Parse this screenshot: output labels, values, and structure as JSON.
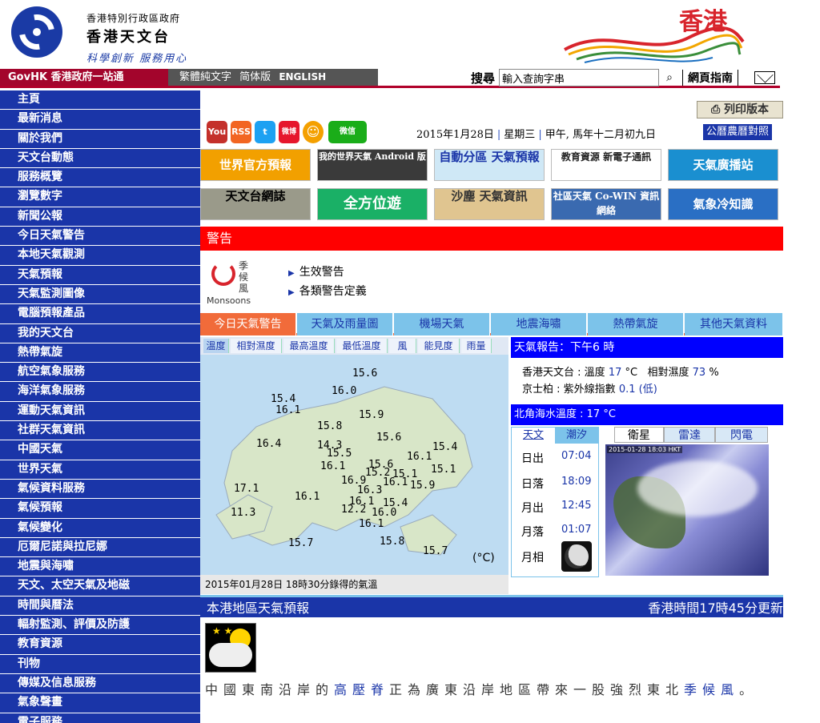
{
  "header": {
    "org_line1": "香港特別行政區政府",
    "org_line2": "香港天文台",
    "slogan": "科學創新 服務用心",
    "brand": "香港"
  },
  "topnav": {
    "govhk": "GovHK 香港政府一站通",
    "langs": [
      "繁體純文字",
      "简体版",
      "ENGLISH"
    ],
    "search_label": "搜尋",
    "search_placeholder": "輸入查詢字串",
    "site_guide": "網頁指南"
  },
  "sidebar": {
    "items": [
      "主頁",
      "最新消息",
      "關於我們",
      "天文台動態",
      "服務概覽",
      "瀏覽數字",
      "新聞公報",
      "今日天氣警告",
      "本地天氣觀測",
      "天氣預報",
      "天氣監測圖像",
      "電腦預報產品",
      "我的天文台",
      "熱帶氣旋",
      "航空氣象服務",
      "海洋氣象服務",
      "運動天氣資訊",
      "社群天氣資訊",
      "中國天氣",
      "世界天氣",
      "氣候資料服務",
      "氣候預報",
      "氣候變化",
      "厄爾尼諾與拉尼娜",
      "地震與海嘯",
      "天文、太空天氣及地磁",
      "時間與曆法",
      "輻射監測、評價及防護",
      "教育資源",
      "刊物",
      "傳媒及信息服務",
      "氣象聲畫",
      "電子服務"
    ]
  },
  "toolbar": {
    "print_label": "列印版本"
  },
  "social": [
    "You",
    "RSS",
    "t",
    "微博",
    "☺",
    "微信"
  ],
  "date": {
    "gregorian": "2015年1月28日",
    "weekday": "星期三",
    "lunar": "甲午, 馬年十二月初九日",
    "lunar_link": "公曆農曆對照"
  },
  "banners": {
    "row1": [
      "世界官方預報",
      "我的世界天氣 Android 版",
      "自動分區 天氣預報",
      "教育資源 新電子通訊",
      "天氣廣播站"
    ],
    "row2": [
      "天文台網誌",
      "全方位遊",
      "沙塵 天氣資訊",
      "社區天氣 Co-WIN 資訊網絡",
      "氣象冷知識"
    ]
  },
  "warnings": {
    "title": "警告",
    "monsoon_chars": "季候風",
    "monsoon_en": "Monsoons",
    "links": [
      "生效警告",
      "各類警告定義"
    ]
  },
  "tabs": [
    "今日天氣警告",
    "天氣及雨量圖",
    "機場天氣",
    "地震海嘯",
    "熱帶氣旋",
    "其他天氣資料"
  ],
  "map": {
    "subtabs": [
      "溫度",
      "相對濕度",
      "最高溫度",
      "最低溫度",
      "風",
      "能見度",
      "雨量"
    ],
    "temps": [
      "15.6",
      "16.0",
      "15.4",
      "16.1",
      "15.9",
      "15.8",
      "15.6",
      "16.4",
      "14.3",
      "15.5",
      "15.4",
      "16.1",
      "16.1",
      "15.6",
      "15.2",
      "15.1",
      "15.1",
      "16.9",
      "16.1",
      "15.9",
      "17.1",
      "16.3",
      "16.1",
      "15.4",
      "16.1",
      "12.2",
      "16.0",
      "11.3",
      "16.1",
      "15.7",
      "15.8",
      "15.7"
    ],
    "unit": "(°C)",
    "caption": "2015年01月28日 18時30分錄得的氣溫"
  },
  "report": {
    "head": "天氣報告：下午6 時",
    "station1": "香港天文台",
    "temp_label": "溫度",
    "temp_value": "17",
    "temp_unit": "°C",
    "rh_label": "相對濕度",
    "rh_value": "73",
    "rh_unit": "%",
    "station2": "京士柏",
    "uv_label": "紫外線指數",
    "uv_value": "0.1",
    "uv_level": "(低)",
    "sea_temp": "北角海水溫度 : 17 °C"
  },
  "astro": {
    "tabs": [
      "天文",
      "潮汐"
    ],
    "sunrise_label": "日出",
    "sunrise": "07:04",
    "sunset_label": "日落",
    "sunset": "18:09",
    "moonrise_label": "月出",
    "moonrise": "12:45",
    "moonset_label": "月落",
    "moonset": "01:07",
    "phase_label": "月相"
  },
  "satellite": {
    "tabs": [
      "衛星",
      "雷達",
      "閃電"
    ],
    "stamp": "2015-01-28 18:03 HKT"
  },
  "forecast": {
    "title": "本港地區天氣預報",
    "updated": "香港時間17時45分更新",
    "text_1": "中國東南沿岸的",
    "text_hl1": "高壓脊",
    "text_2": "正為廣東沿岸地區帶來一股強烈東北",
    "text_hl2": "季候風",
    "text_3": "。"
  }
}
